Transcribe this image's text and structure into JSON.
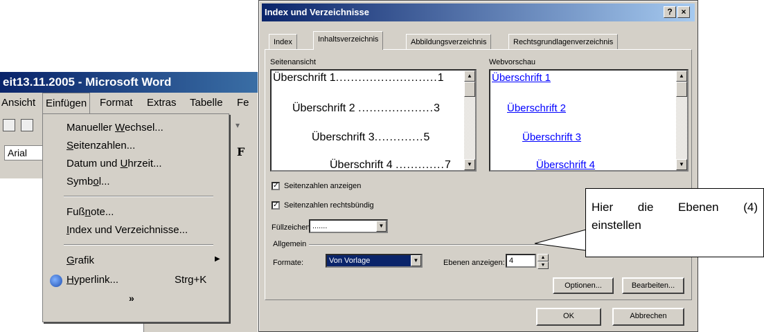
{
  "word": {
    "title": "eit13.11.2005 - Microsoft Word",
    "menu": [
      "Ansicht",
      "Einfügen",
      "Format",
      "Extras",
      "Tabelle",
      "Fe"
    ],
    "font": "Arial",
    "bold": "F",
    "insert_menu": {
      "items": [
        {
          "label": "Manueller Wechsel..."
        },
        {
          "label": "Seitenzahlen..."
        },
        {
          "label": "Datum und Uhrzeit..."
        },
        {
          "label": "Symbol..."
        },
        {
          "label": "Fußnote..."
        },
        {
          "label": "Index und Verzeichnisse..."
        },
        {
          "label": "Grafik",
          "submenu_icon": "triangle-right-icon"
        },
        {
          "label": "Hyperlink...",
          "shortcut": "Strg+K",
          "icon": "hyperlink-globe-icon"
        }
      ],
      "expand": "»"
    }
  },
  "dialog": {
    "title": "Index und Verzeichnisse",
    "help": "?",
    "close": "×",
    "tabs": [
      "Index",
      "Inhaltsverzeichnis",
      "Abbildungsverzeichnis",
      "Rechtsgrundlagenverzeichnis"
    ],
    "active_tab": "Inhaltsverzeichnis",
    "print_preview_label": "Seitenansicht",
    "print_preview": [
      {
        "text": "Überschrift 1",
        "dots": "...........................",
        "page": "1"
      },
      {
        "text": "Überschrift 2",
        "dots": "....................",
        "page": "3"
      },
      {
        "text": "Überschrift 3",
        "dots": ".............",
        "page": "5"
      },
      {
        "text": "Überschrift 4",
        "dots": ".............",
        "page": "7"
      }
    ],
    "web_preview_label": "Webvorschau",
    "web_preview": [
      "Überschrift 1",
      "Überschrift 2",
      "Überschrift 3",
      "Überschrift 4"
    ],
    "show_page_numbers": "Seitenzahlen anzeigen",
    "right_align": "Seitenzahlen rechtsbündig",
    "tab_leader_label": "Füllzeichen:",
    "tab_leader_value": ".......",
    "general_label": "Allgemein",
    "formats_label": "Formate:",
    "formats_value": "Von Vorlage",
    "levels_label": "Ebenen anzeigen:",
    "levels_value": "4",
    "options_button": "Optionen...",
    "edit_button": "Bearbeiten...",
    "ok_button": "OK",
    "cancel_button": "Abbrechen"
  },
  "callout": {
    "line1": "Hier die Ebenen (4)",
    "line2": "einstellen"
  }
}
